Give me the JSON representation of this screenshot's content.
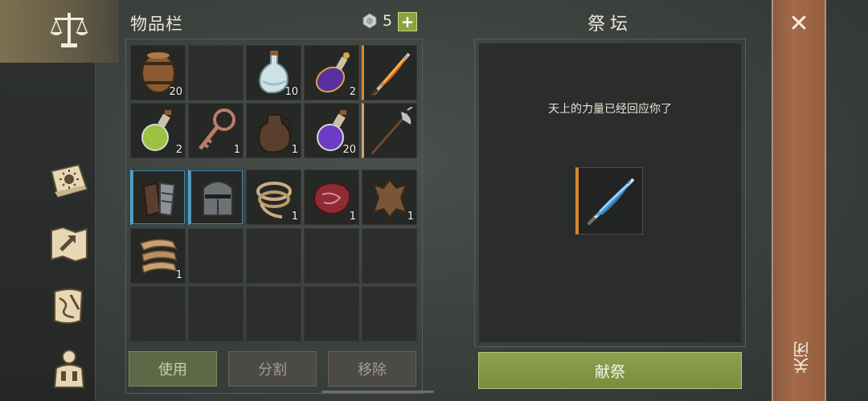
{
  "inventory": {
    "title": "物品栏",
    "gem_count": "5",
    "plus_label": "+",
    "slots_row1": [
      {
        "name": "barrel-icon",
        "count": "20"
      },
      {
        "name": "empty",
        "count": ""
      },
      {
        "name": "water-flask-icon",
        "count": "10"
      },
      {
        "name": "purple-potion-icon",
        "count": "2"
      },
      {
        "name": "flame-sword-icon",
        "count": ""
      }
    ],
    "slots_row2": [
      {
        "name": "green-potion-icon",
        "count": "2"
      },
      {
        "name": "key-icon",
        "count": "1"
      },
      {
        "name": "leather-flask-icon",
        "count": "1"
      },
      {
        "name": "violet-potion-icon",
        "count": "20"
      },
      {
        "name": "halberd-icon",
        "count": ""
      }
    ],
    "slots_row3": [
      {
        "name": "gauntlets-icon",
        "count": ""
      },
      {
        "name": "helmet-icon",
        "count": ""
      },
      {
        "name": "rope-icon",
        "count": "1"
      },
      {
        "name": "meat-icon",
        "count": "1"
      },
      {
        "name": "hide-icon",
        "count": "1"
      }
    ],
    "slots_row4": [
      {
        "name": "cloth-icon",
        "count": "1"
      }
    ],
    "buttons": {
      "use": "使用",
      "split": "分割",
      "remove": "移除"
    }
  },
  "altar": {
    "title": "祭坛",
    "message": "天上的力量已经回应你了",
    "offer_label": "献祭"
  },
  "close": {
    "icon": "close-icon",
    "label": "关闭"
  },
  "colors": {
    "accent_green": "#8fa04f",
    "rare_orange": "#d9892d",
    "equipped_blue": "#4ea3c7",
    "close_bar": "#a46a4a"
  }
}
